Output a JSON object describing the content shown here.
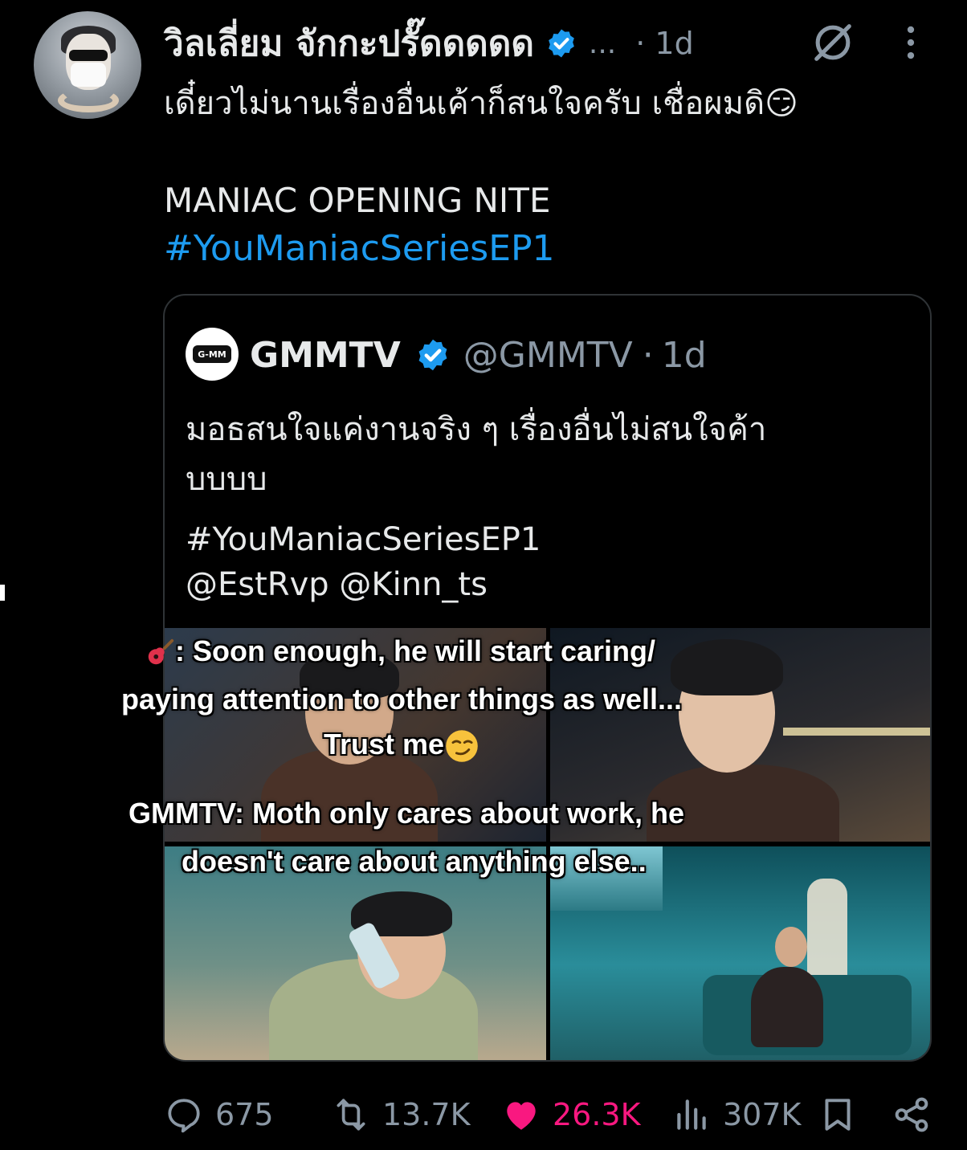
{
  "post": {
    "display_name": "วิลเลี่ยม จักกะปรั๊ดดดดด",
    "truncation": "...",
    "timestamp": "· 1d",
    "text_line1": "เดี๋ยวไม่นานเรื่องอื่นเค้าก็สนใจครับ เชื่อผมดิ😏",
    "text_line2": "MANIAC OPENING NITE",
    "hashtag": "#YouManiacSeriesEP1"
  },
  "quoted": {
    "logo_text": "G-MM",
    "name": "GMMTV",
    "handle": "@GMMTV",
    "separator": "·",
    "timestamp": "1d",
    "text_line1": "มอธสนใจแค่งานจริง ๆ เรื่องอื่นไม่สนใจค้า",
    "text_line2": "บบบบ",
    "hashtag": "#YouManiacSeriesEP1",
    "mentions": "@EstRvp @Kinn_ts"
  },
  "captions": {
    "line1": ": Soon enough, he will start caring/",
    "line2": "paying attention to other things as well...",
    "line3": "Trust me",
    "line4": "GMMTV: Moth only cares about work, he",
    "line5": "doesn't care about anything else.."
  },
  "actions": {
    "replies": "675",
    "reposts": "13.7K",
    "likes": "26.3K",
    "views": "307K"
  },
  "colors": {
    "background": "#000000",
    "text": "#e7e9ea",
    "secondary": "#8b98a5",
    "link": "#1d9bf0",
    "like": "#f91880",
    "verified": "#1d9bf0"
  }
}
